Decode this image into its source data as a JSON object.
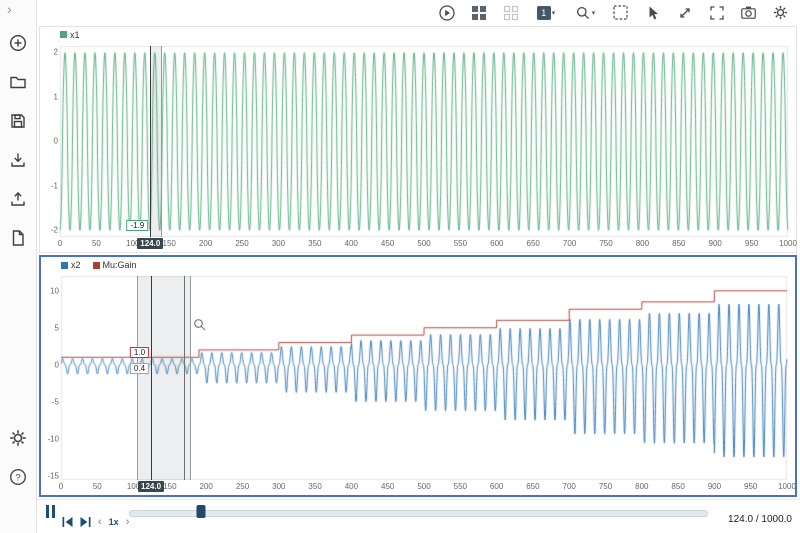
{
  "sidebar": {
    "items": [
      {
        "name": "collapse-panel"
      },
      {
        "name": "add"
      },
      {
        "name": "open-folder"
      },
      {
        "name": "save"
      },
      {
        "name": "import"
      },
      {
        "name": "export"
      },
      {
        "name": "new-report"
      },
      {
        "name": "settings"
      },
      {
        "name": "help"
      }
    ]
  },
  "topbar": {
    "display_button_label": "1",
    "buttons": [
      {
        "name": "run"
      },
      {
        "name": "grid-layout"
      },
      {
        "name": "grid-layout-alt"
      },
      {
        "name": "display-select"
      },
      {
        "name": "zoom-options"
      },
      {
        "name": "fit-to-view"
      },
      {
        "name": "pointer-tool"
      },
      {
        "name": "expand-diagonal"
      },
      {
        "name": "fullscreen"
      },
      {
        "name": "snapshot"
      },
      {
        "name": "settings"
      }
    ]
  },
  "transport": {
    "speed": "1x",
    "position": "124.0 / 1000.0",
    "slider": {
      "value": 124,
      "max": 1000
    }
  },
  "chart_data": [
    {
      "type": "line",
      "legend": [
        {
          "label": "x1",
          "color": "#4aa877"
        }
      ],
      "x_range": [
        0,
        1000
      ],
      "x_ticks": [
        0,
        50,
        100,
        150,
        200,
        250,
        300,
        350,
        400,
        450,
        500,
        550,
        600,
        650,
        700,
        750,
        800,
        850,
        900,
        950,
        1000
      ],
      "y_range": [
        -2.15,
        2.15
      ],
      "y_ticks": [
        2,
        1,
        0,
        -1,
        -2
      ],
      "series": [
        {
          "name": "x1",
          "color": "#4aa877",
          "kind": "oscillation",
          "amplitude": 2,
          "period": 13.7,
          "sharpness": 0.8,
          "phase": 4.71
        }
      ],
      "selection": {
        "from": 124,
        "to": 138,
        "lines": []
      },
      "cursor": {
        "x": 124,
        "axis_label": "124.0",
        "badges": [
          {
            "text": "-1.9",
            "border": "#4aa877",
            "y": -1.9
          }
        ]
      }
    },
    {
      "type": "line",
      "legend": [
        {
          "label": "x2",
          "color": "#2e75b6"
        },
        {
          "label": "Mu:Gain",
          "color": "#b23b34"
        }
      ],
      "x_range": [
        0,
        1000
      ],
      "x_ticks": [
        0,
        50,
        100,
        150,
        200,
        250,
        300,
        350,
        400,
        450,
        500,
        550,
        600,
        650,
        700,
        750,
        800,
        850,
        900,
        950,
        1000
      ],
      "y_range": [
        -15.6,
        12.0
      ],
      "y_ticks": [
        10,
        5,
        0,
        -5,
        -10,
        -15
      ],
      "series": [
        {
          "name": "x2",
          "color": "#2e75b6",
          "kind": "growing-oscillation",
          "period": 13.7,
          "sharpness": 2.6,
          "phase": 0.54,
          "pos_scale": 0.82,
          "neg_scale": 1.25,
          "gain_steps": {
            "t": [
              0,
              190,
              300,
              400,
              500,
              600,
              700,
              800,
              900
            ],
            "v": [
              1,
              2,
              3,
              4,
              5,
              6,
              7.5,
              8.5,
              10
            ]
          }
        },
        {
          "name": "Mu:Gain",
          "color": "#b23b34",
          "kind": "steps",
          "steps": {
            "t": [
              0,
              190,
              300,
              400,
              500,
              600,
              700,
              800,
              900
            ],
            "v": [
              1,
              2,
              3,
              4,
              5,
              6,
              7.5,
              8.5,
              10
            ]
          }
        }
      ],
      "selection": {
        "from": 105,
        "to": 176,
        "lines": [
          170
        ]
      },
      "cursor": {
        "x": 124,
        "axis_label": "124.0",
        "badges": [
          {
            "text": "1.0",
            "border": "#b23b34",
            "y": 1.6
          },
          {
            "text": "0.4",
            "border": "#9aa7b0",
            "y": -0.6
          }
        ]
      },
      "zoom_icon_at": {
        "x": 182,
        "y": 6.3
      }
    }
  ]
}
